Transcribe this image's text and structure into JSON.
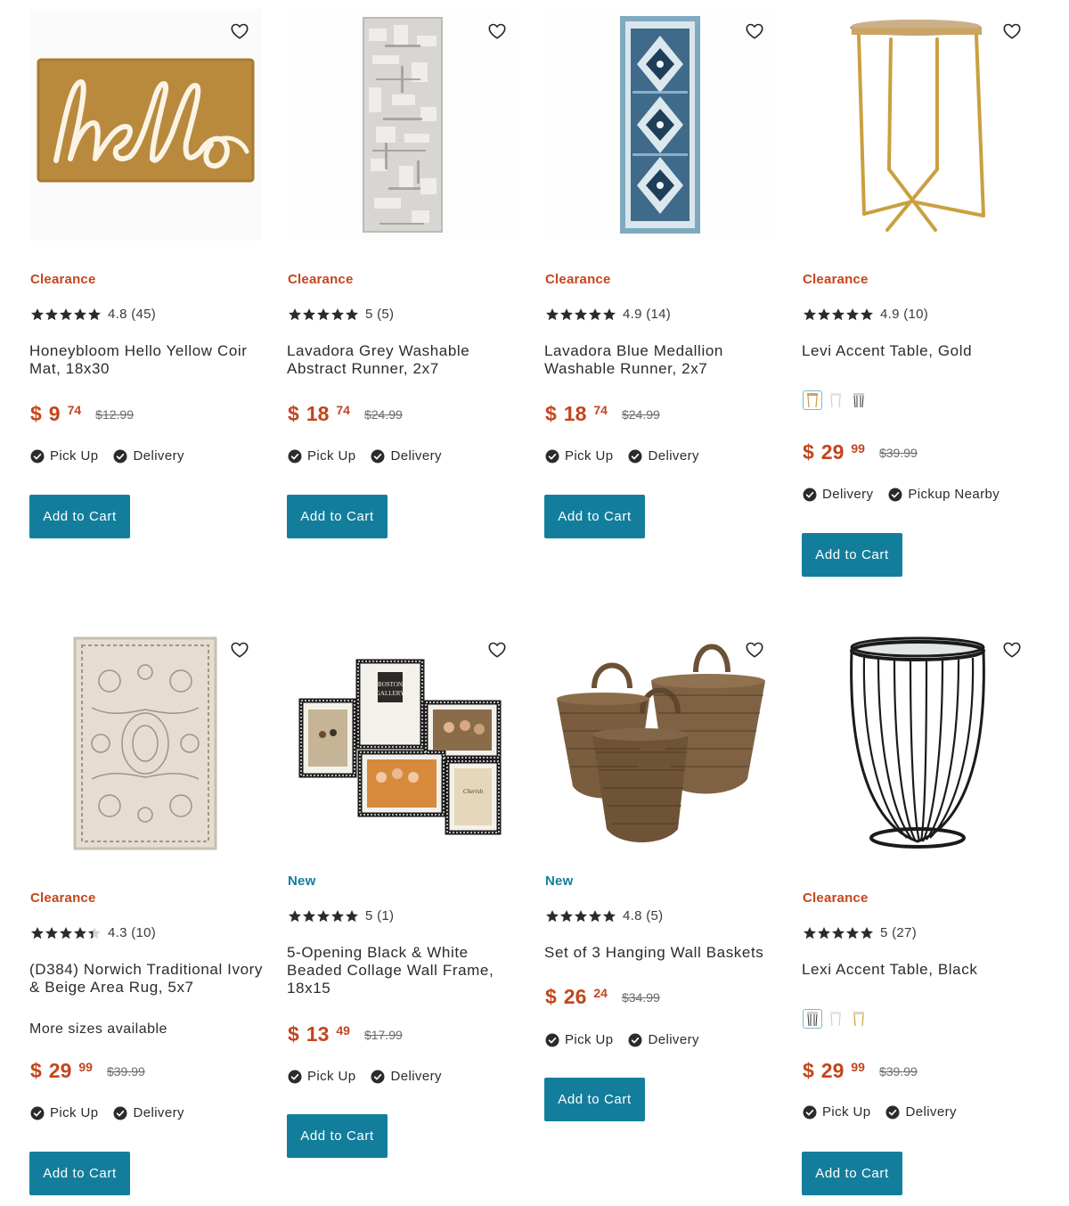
{
  "colors": {
    "clearance": "#c4451c",
    "new": "#137e9c",
    "price": "#c4451c",
    "button": "#137e9c"
  },
  "icons": {
    "wishlist": "heart-outline-icon",
    "fulfillment": "check-circle-icon",
    "rating": "star-icon"
  },
  "products": [
    {
      "badge": "Clearance",
      "rating_value": 4.8,
      "rating_text": "4.8 (45)",
      "title": "Honeybloom Hello Yellow Coir Mat, 18x30",
      "price_symbol": "$",
      "price_dollars": "9",
      "price_cents": "74",
      "price_was": "$12.99",
      "fulfillment": [
        "Pick Up",
        "Delivery"
      ],
      "button": "Add to Cart"
    },
    {
      "badge": "Clearance",
      "rating_value": 5,
      "rating_text": "5 (5)",
      "title": "Lavadora Grey Washable Abstract Runner, 2x7",
      "price_symbol": "$",
      "price_dollars": "18",
      "price_cents": "74",
      "price_was": "$24.99",
      "fulfillment": [
        "Pick Up",
        "Delivery"
      ],
      "button": "Add to Cart"
    },
    {
      "badge": "Clearance",
      "rating_value": 4.9,
      "rating_text": "4.9 (14)",
      "title": "Lavadora Blue Medallion Washable Runner, 2x7",
      "price_symbol": "$",
      "price_dollars": "18",
      "price_cents": "74",
      "price_was": "$24.99",
      "fulfillment": [
        "Pick Up",
        "Delivery"
      ],
      "button": "Add to Cart"
    },
    {
      "badge": "Clearance",
      "rating_value": 4.9,
      "rating_text": "4.9 (10)",
      "title": "Levi Accent Table, Gold",
      "swatches": [
        "gold",
        "white",
        "black"
      ],
      "price_symbol": "$",
      "price_dollars": "29",
      "price_cents": "99",
      "price_was": "$39.99",
      "fulfillment": [
        "Delivery",
        "Pickup Nearby"
      ],
      "button": "Add to Cart"
    },
    {
      "badge": "Clearance",
      "rating_value": 4.3,
      "rating_text": "4.3 (10)",
      "title": "(D384) Norwich Traditional Ivory & Beige Area Rug, 5x7",
      "sizes_note": "More sizes available",
      "price_symbol": "$",
      "price_dollars": "29",
      "price_cents": "99",
      "price_was": "$39.99",
      "fulfillment": [
        "Pick Up",
        "Delivery"
      ],
      "button": "Add to Cart"
    },
    {
      "badge": "New",
      "rating_value": 5,
      "rating_text": "5 (1)",
      "title": "5-Opening Black & White Beaded Collage Wall Frame, 18x15",
      "price_symbol": "$",
      "price_dollars": "13",
      "price_cents": "49",
      "price_was": "$17.99",
      "fulfillment": [
        "Pick Up",
        "Delivery"
      ],
      "button": "Add to Cart"
    },
    {
      "badge": "New",
      "rating_value": 4.8,
      "rating_text": "4.8 (5)",
      "title": "Set of 3 Hanging Wall Baskets",
      "price_symbol": "$",
      "price_dollars": "26",
      "price_cents": "24",
      "price_was": "$34.99",
      "fulfillment": [
        "Pick Up",
        "Delivery"
      ],
      "button": "Add to Cart"
    },
    {
      "badge": "Clearance",
      "rating_value": 5,
      "rating_text": "5 (27)",
      "title": "Lexi Accent Table, Black",
      "swatches": [
        "black",
        "white",
        "gold"
      ],
      "price_symbol": "$",
      "price_dollars": "29",
      "price_cents": "99",
      "price_was": "$39.99",
      "fulfillment": [
        "Pick Up",
        "Delivery"
      ],
      "button": "Add to Cart"
    }
  ]
}
